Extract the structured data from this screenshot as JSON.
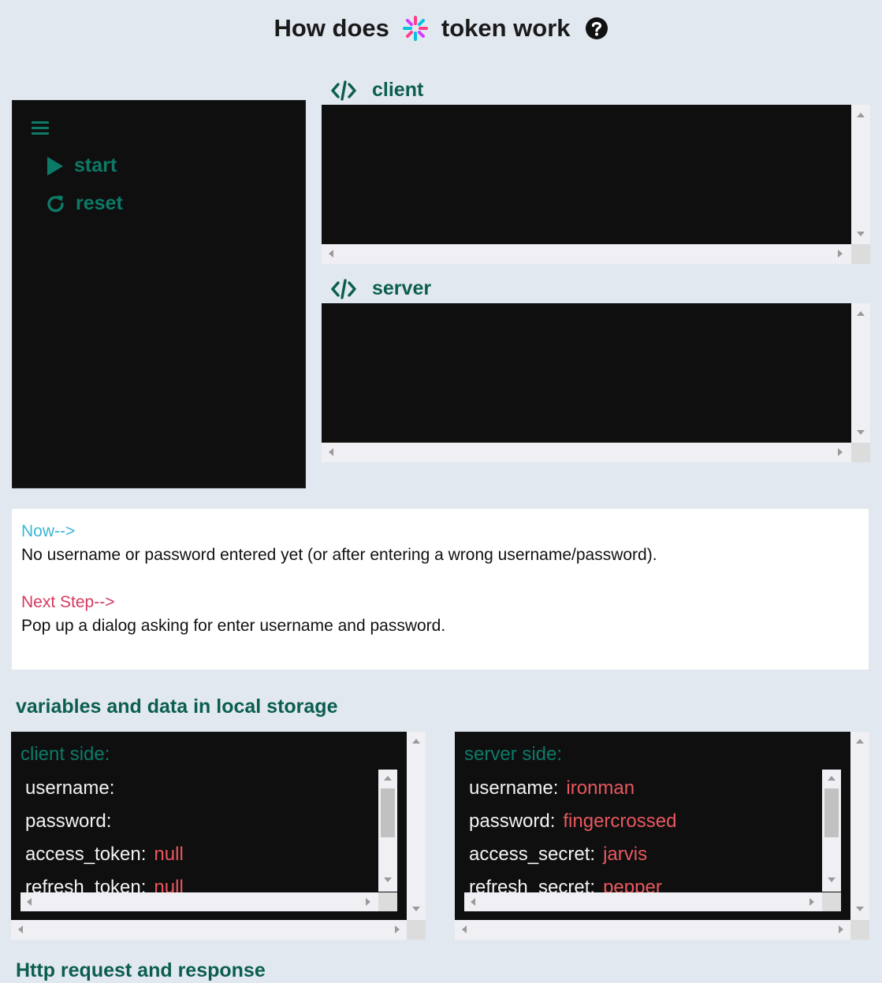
{
  "header": {
    "title_before": "How does",
    "title_after": "token work",
    "logo_icon": "jwt-logo-icon",
    "help_icon": "question-circle-icon"
  },
  "menu": {
    "hamburger_icon": "hamburger-icon",
    "start_label": "start",
    "reset_label": "reset"
  },
  "panels": {
    "client_label": "client",
    "server_label": "server"
  },
  "info": {
    "now_label": "Now-->",
    "now_text": "No username or password entered yet (or after entering a wrong username/password).",
    "next_label": "Next Step-->",
    "next_text": "Pop up a dialog asking for enter username and password."
  },
  "storage": {
    "title": "variables and data in local storage",
    "client": {
      "label": "client side:",
      "rows": [
        {
          "key": "username:",
          "value": ""
        },
        {
          "key": "password:",
          "value": ""
        },
        {
          "key": "access_token:",
          "value": "null"
        },
        {
          "key": "refresh_token:",
          "value": "null"
        }
      ]
    },
    "server": {
      "label": "server side:",
      "rows": [
        {
          "key": "username:",
          "value": "ironman"
        },
        {
          "key": "password:",
          "value": "fingercrossed"
        },
        {
          "key": "access_secret:",
          "value": "jarvis"
        },
        {
          "key": "refresh_secret:",
          "value": "pepper"
        }
      ]
    }
  },
  "http": {
    "title": "Http request and response"
  },
  "colors": {
    "accent": "#0d7a67",
    "heading": "#0b5e4f",
    "value": "#e8585e",
    "now": "#3cb6d6",
    "next": "#d63a5d"
  }
}
